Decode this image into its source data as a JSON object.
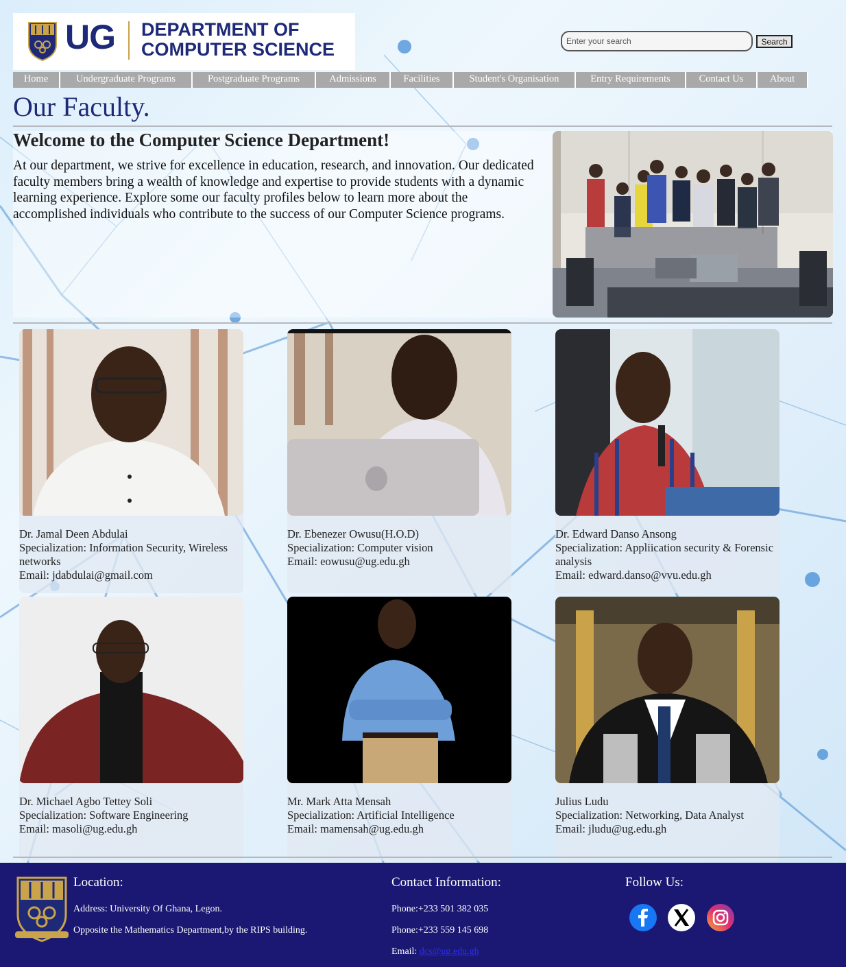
{
  "header": {
    "logo": {
      "short": "UG",
      "line1": "DEPARTMENT OF",
      "line2": "COMPUTER SCIENCE"
    },
    "search": {
      "placeholder": "Enter your search",
      "button_label": "Search"
    }
  },
  "nav": {
    "items": [
      {
        "label": "Home",
        "width": 69
      },
      {
        "label": "Undergraduate Programs",
        "width": 193
      },
      {
        "label": "Postgraduate Programs",
        "width": 180
      },
      {
        "label": "Admissions",
        "width": 109
      },
      {
        "label": "Facilities",
        "width": 92
      },
      {
        "label": "Student's Organisation",
        "width": 178
      },
      {
        "label": "Entry Requirements",
        "width": 161
      },
      {
        "label": "Contact Us",
        "width": 104
      },
      {
        "label": "About",
        "width": 74
      }
    ]
  },
  "page_title": "Our Faculty.",
  "welcome": {
    "title": "Welcome to the Computer Science Department!",
    "body": "At our department, we strive for excellence in education, research, and innovation. Our dedicated faculty members bring a wealth of knowledge and expertise to provide students with a dynamic learning experience. Explore some our faculty profiles below to learn more about the accomplished individuals who contribute to the success of our Computer Science programs."
  },
  "faculty": [
    {
      "name": "Dr. Jamal Deen Abdulai",
      "specialization": "Specialization: Information Security, Wireless networks",
      "email": "Email: jdabdulai@gmail.com"
    },
    {
      "name": "Dr. Ebenezer Owusu(H.O.D)",
      "specialization": "Specialization: Computer vision",
      "email": "Email: eowusu@ug.edu.gh"
    },
    {
      "name": "Dr. Edward Danso Ansong",
      "specialization": "Specialization: Appliication security & Forensic analysis",
      "email": "Email: edward.danso@vvu.edu.gh"
    },
    {
      "name": "Dr. Michael Agbo Tettey Soli",
      "specialization": "Specialization: Software Engineering",
      "email": "Email: masoli@ug.edu.gh"
    },
    {
      "name": "Mr. Mark Atta Mensah",
      "specialization": "Specialization: Artificial Intelligence",
      "email": "Email: mamensah@ug.edu.gh"
    },
    {
      "name": "Julius Ludu",
      "specialization": "Specialization: Networking, Data Analyst",
      "email": "Email: jludu@ug.edu.gh"
    }
  ],
  "footer": {
    "location_title": "Location:",
    "address": "Address: University Of Ghana, Legon.",
    "address2": "Opposite the Mathematics Department,by the RIPS building.",
    "contact_title": "Contact Information:",
    "phone1": "Phone:+233 501 382 035",
    "phone2": "Phone:+233 559 145 698",
    "email_label": "Email:",
    "email_link": "dcs@ug.edu.gh",
    "follow_title": "Follow Us:",
    "social": [
      "facebook-icon",
      "x-twitter-icon",
      "instagram-icon"
    ]
  },
  "colors": {
    "brand_navy": "#1e2a78",
    "footer_bg": "#1a1872",
    "nav_bg": "#a9a9a9",
    "accent_gold": "#c9a44b"
  }
}
